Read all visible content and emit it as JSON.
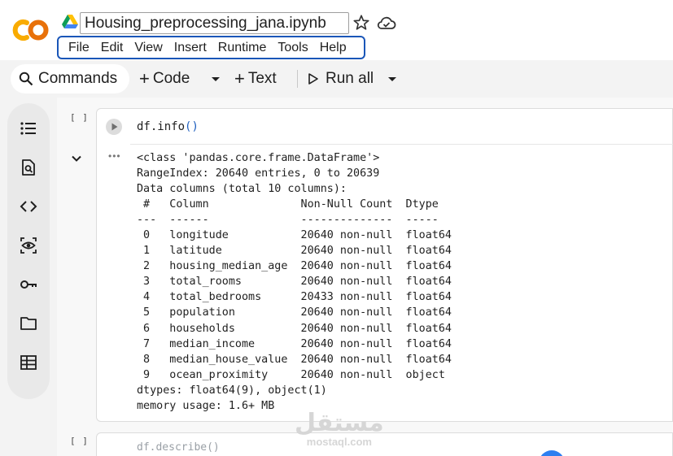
{
  "notebook": {
    "title": "Housing_preprocessing_jana.ipynb",
    "menu": [
      "File",
      "Edit",
      "View",
      "Insert",
      "Runtime",
      "Tools",
      "Help"
    ]
  },
  "toolbar": {
    "commands_label": "Commands",
    "code_label": "Code",
    "text_label": "Text",
    "run_all_label": "Run all"
  },
  "rail_icons": [
    "table-of-contents-icon",
    "find-replace-icon",
    "code-snippets-icon",
    "variables-icon",
    "secrets-key-icon",
    "files-folder-icon",
    "data-table-icon"
  ],
  "cells": [
    {
      "exec_bracket": "[ ]",
      "code": "df.info",
      "code_parens": "()",
      "output_lines": [
        "<class 'pandas.core.frame.DataFrame'>",
        "RangeIndex: 20640 entries, 0 to 20639",
        "Data columns (total 10 columns):",
        " #   Column              Non-Null Count  Dtype  ",
        "---  ------              --------------  -----  ",
        " 0   longitude           20640 non-null  float64",
        " 1   latitude            20640 non-null  float64",
        " 2   housing_median_age  20640 non-null  float64",
        " 3   total_rooms         20640 non-null  float64",
        " 4   total_bedrooms      20433 non-null  float64",
        " 5   population          20640 non-null  float64",
        " 6   households          20640 non-null  float64",
        " 7   median_income       20640 non-null  float64",
        " 8   median_house_value  20640 non-null  float64",
        " 9   ocean_proximity     20640 non-null  object ",
        "dtypes: float64(9), object(1)",
        "memory usage: 1.6+ MB"
      ]
    },
    {
      "exec_bracket": "[ ]",
      "code": "df.describe()"
    }
  ],
  "watermark": {
    "arabic": "مستقل",
    "latin": "mostaql.com"
  },
  "colors": {
    "menubar_border": "#1a56b8",
    "toolbar_bg": "#f3f3f3",
    "logo_orange": "#f9ab00",
    "logo_dark_orange": "#e8710a"
  }
}
